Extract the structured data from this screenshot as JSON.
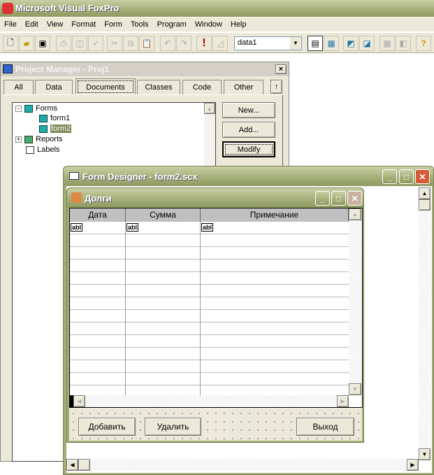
{
  "app": {
    "title": "Microsoft Visual FoxPro"
  },
  "menu": [
    "File",
    "Edit",
    "View",
    "Format",
    "Form",
    "Tools",
    "Program",
    "Window",
    "Help"
  ],
  "toolbar": {
    "datasession": "data1"
  },
  "project_manager": {
    "title": "Project Manager - Proj1",
    "close": "×",
    "tabs": [
      "All",
      "Data",
      "Documents",
      "Classes",
      "Code",
      "Other"
    ],
    "collapse": "↑",
    "tree": {
      "forms": "Forms",
      "form1": "form1",
      "form2": "form2",
      "reports": "Reports",
      "labels": "Labels"
    },
    "buttons": {
      "new": "New...",
      "add": "Add...",
      "modify": "Modify"
    }
  },
  "form_designer": {
    "title": "Form Designer - form2.scx"
  },
  "form": {
    "title": "Долги",
    "columns": [
      "Дата",
      "Сумма",
      "Примечание"
    ],
    "cell_placeholder": "abl",
    "buttons": {
      "add": "Добавить",
      "delete": "Удалить",
      "exit": "Выход"
    }
  }
}
